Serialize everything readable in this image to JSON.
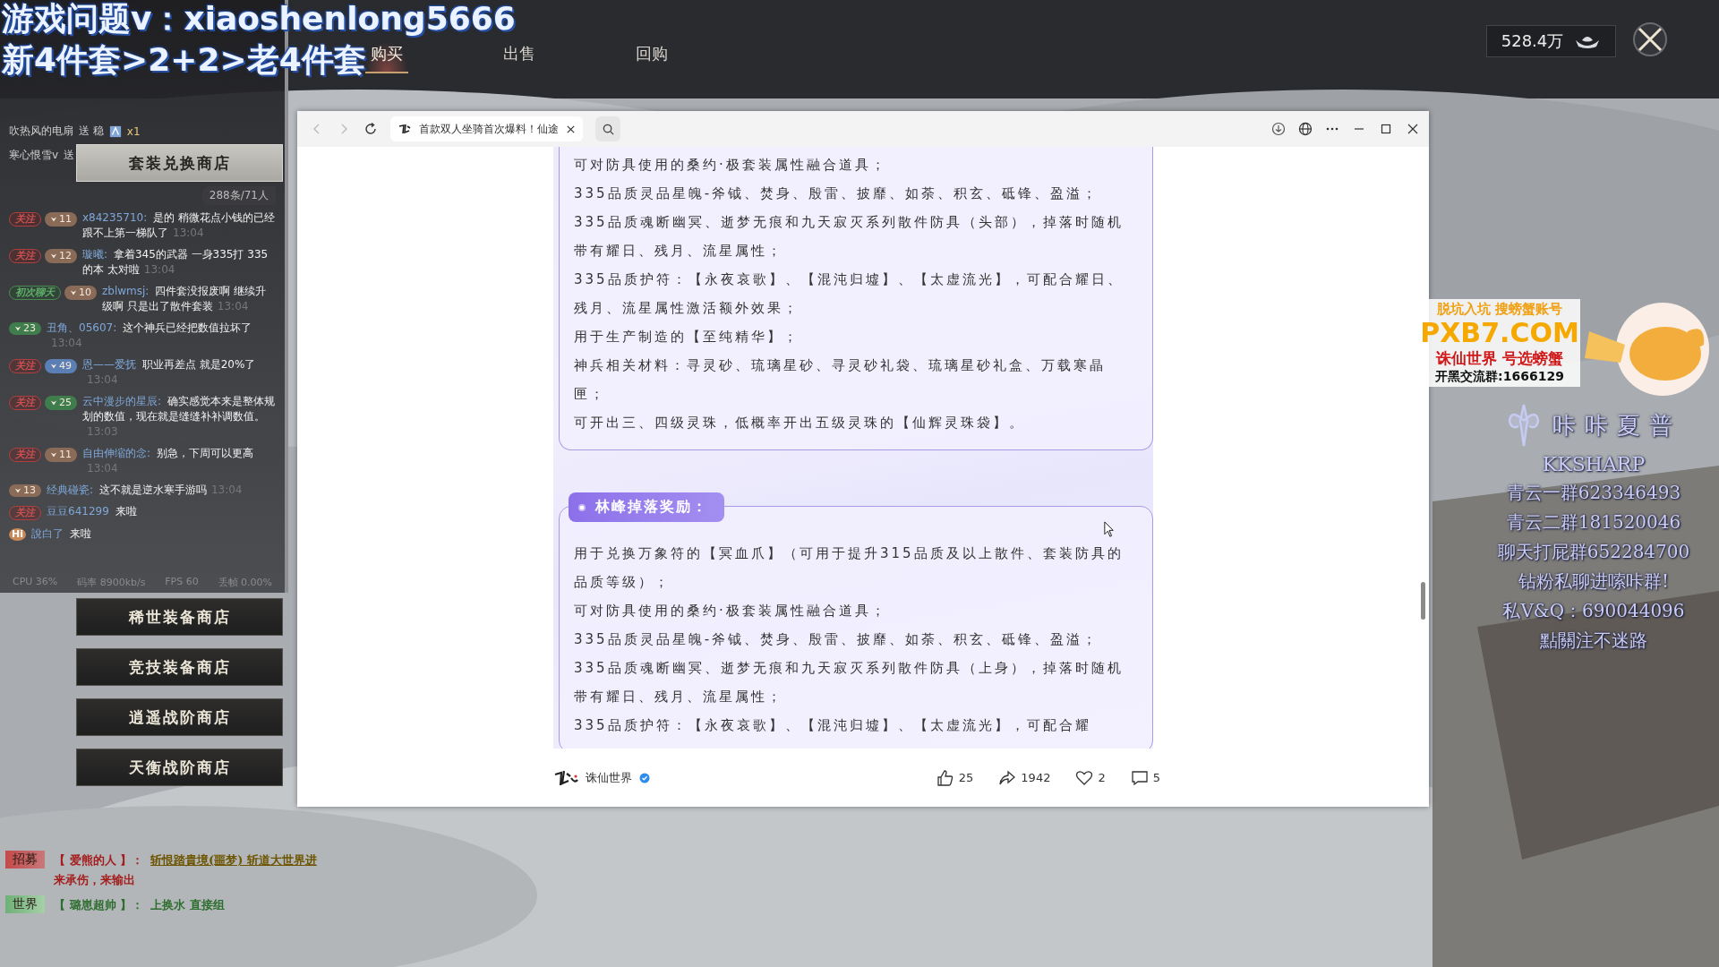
{
  "stream_overlay": {
    "headline": "游戏问题v：xiaoshenlong5666",
    "subline": "新4件套>2+2>老4件套"
  },
  "game": {
    "tabs": [
      {
        "label": "购买",
        "selected": true
      },
      {
        "label": "出售",
        "selected": false
      },
      {
        "label": "回购",
        "selected": false
      }
    ],
    "currency": "528.4万",
    "shops": [
      {
        "label": "套装兑换商店",
        "selected": true
      },
      {
        "label": "稀世装备商店",
        "selected": false
      },
      {
        "label": "竞技装备商店",
        "selected": false
      },
      {
        "label": "逍遥战阶商店",
        "selected": false
      },
      {
        "label": "天衡战阶商店",
        "selected": false
      }
    ],
    "world_chat": [
      {
        "channel": "招募",
        "kind": "recruit",
        "parts": [
          {
            "kind": "name",
            "text": "【 爱熊的人 】："
          },
          {
            "kind": "link",
            "text": "斩恨踏貴境(噩梦) 斩道大世界进"
          },
          {
            "kind": "body",
            "text": "来承伤，来输出"
          }
        ]
      },
      {
        "channel": "世界",
        "kind": "world",
        "parts": [
          {
            "kind": "name",
            "text": "【 璐崽超帅 】："
          },
          {
            "kind": "body",
            "text": "上换水 直接组"
          }
        ]
      }
    ]
  },
  "live_chat": {
    "gifts": [
      {
        "user": "吹热风的电扇",
        "verb": "送 稳",
        "count": "x1"
      },
      {
        "user": "寒心恨雪v",
        "verb": "送"
      }
    ],
    "counter": "288条/71人",
    "messages": [
      {
        "tag": {
          "kind": "follow",
          "label": "关注"
        },
        "level": "11",
        "color": "#8a6b57",
        "user": "x84235710:",
        "text": "是的 稍微花点小钱的已经跟不上第一梯队了",
        "time": "13:04"
      },
      {
        "tag": {
          "kind": "follow",
          "label": "关注"
        },
        "level": "12",
        "color": "#8a6b57",
        "user": "璇曦:",
        "text": "拿着345的武器 一身335打 335的本 太对啦",
        "time": "13:04"
      },
      {
        "tag": {
          "kind": "first",
          "label": "初次聊天"
        },
        "level": "10",
        "color": "#8a6b57",
        "user": "zblwmsj:",
        "text": "四件套没报废啊 继续升级啊 只是出了散件套装",
        "time": "13:04"
      },
      {
        "level": "23",
        "color": "#3f7d4c",
        "user": "丑角、05607:",
        "text": "这个神兵已经把数值拉坏了",
        "time": "13:04"
      },
      {
        "tag": {
          "kind": "follow",
          "label": "关注"
        },
        "level": "49",
        "color": "#5b7fb5",
        "user": "恩——爱抚",
        "text": "职业再差点 就是20%了",
        "time": "13:04"
      },
      {
        "tag": {
          "kind": "follow",
          "label": "关注"
        },
        "level": "25",
        "color": "#3f7d4c",
        "user": "云中漫步的星辰:",
        "text": "确实感觉本来是整体规划的数值，现在就是缝缝补补调数值。",
        "time": "13:03"
      },
      {
        "tag": {
          "kind": "follow",
          "label": "关注"
        },
        "level": "11",
        "color": "#8a6b57",
        "user": "自由伸缩的念:",
        "text": "别急，下周可以更高",
        "time": "13:04"
      },
      {
        "level": "13",
        "color": "#8a6b57",
        "user": "经典碰瓷:",
        "text": "这不就是逆水寒手游吗",
        "time": "13:04"
      },
      {
        "tag": {
          "kind": "follow",
          "label": "关注"
        },
        "user": "豆豆641299",
        "text": "来啦"
      },
      {
        "tag": {
          "kind": "hi",
          "label": "Hi"
        },
        "user": "說白了",
        "text": "来啦"
      }
    ],
    "perf": [
      "CPU 36%",
      "码率 8900kb/s",
      "FPS 60",
      "丢帧 0.00%"
    ]
  },
  "browser": {
    "tab_title": "首款双人坐骑首次爆料！仙途",
    "sections": [
      {
        "lines": [
          "可对防具使用的桑约·极套装属性融合道具；",
          "335品质灵品星魄-斧钺、焚身、殷雷、披靡、如荼、积玄、砥锋、盈溢；",
          "335品质魂断幽冥、逝梦无痕和九天寂灭系列散件防具（头部），掉落时随机带有耀日、残月、流星属性；",
          "335品质护符：【永夜哀歌】、【混沌归墟】、【太虚流光】，可配合耀日、残月、流星属性激活额外效果；",
          "用于生产制造的【至纯精华】；",
          "神兵相关材料：寻灵砂、琉璃星砂、寻灵砂礼袋、琉璃星砂礼盒、万载寒晶匣；",
          "可开出三、四级灵珠，低概率开出五级灵珠的【仙辉灵珠袋】。"
        ]
      },
      {
        "heading": "林峰掉落奖励：",
        "lines": [
          "用于兑换万象符的【冥血爪】（可用于提升315品质及以上散件、套装防具的品质等级）；",
          "可对防具使用的桑约·极套装属性融合道具；",
          "335品质灵品星魄-斧钺、焚身、殷雷、披靡、如荼、积玄、砥锋、盈溢；",
          "335品质魂断幽冥、逝梦无痕和九天寂灭系列散件防具（上身），掉落时随机带有耀日、残月、流星属性；",
          "335品质护符：【永夜哀歌】、【混沌归墟】、【太虚流光】，可配合耀"
        ]
      }
    ],
    "footer": {
      "author": "诛仙世界",
      "verified": true,
      "likes": "25",
      "shares": "1942",
      "favorites": "2",
      "comments": "5"
    }
  },
  "ad": {
    "slogan": "脱坑入坑 搜螃蟹账号",
    "site": "PXB7.COM",
    "tagline": "诛仙世界 号选螃蟹",
    "group": "开黑交流群:1666129"
  },
  "streamer_card": {
    "name": "咔咔夏普",
    "latin": "KKSHARP",
    "lines": [
      "青云一群623346493",
      "青云二群181520046",
      "聊天打屁群652284700",
      "钻粉私聊进嗦咔群!",
      "私V&Q：690044096",
      "點關注不迷路"
    ]
  }
}
